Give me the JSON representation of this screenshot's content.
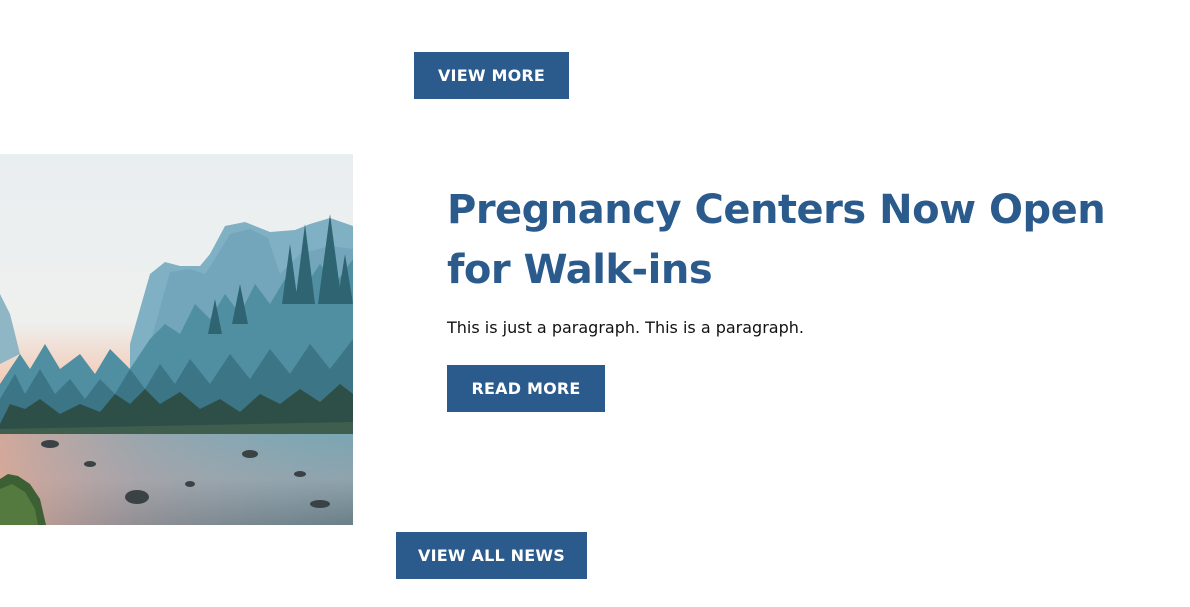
{
  "top_section": {
    "view_more_label": "VIEW MORE"
  },
  "news_item": {
    "image_alt": "Mountain valley with river, pine forest and misty cliffs at sunset",
    "title": "Pregnancy Centers Now Open for Walk-ins",
    "paragraph": "This is just a paragraph. This is a paragraph.",
    "read_more_label": "READ MORE"
  },
  "footer_section": {
    "view_all_label": "VIEW ALL NEWS"
  },
  "colors": {
    "brand_blue": "#2a5b8c",
    "text": "#111111",
    "background": "#ffffff"
  }
}
